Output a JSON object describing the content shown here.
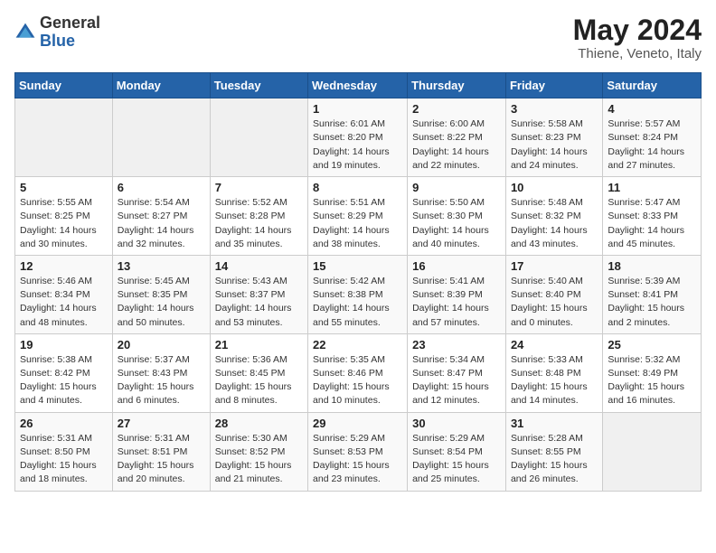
{
  "logo": {
    "general": "General",
    "blue": "Blue"
  },
  "title": "May 2024",
  "subtitle": "Thiene, Veneto, Italy",
  "weekdays": [
    "Sunday",
    "Monday",
    "Tuesday",
    "Wednesday",
    "Thursday",
    "Friday",
    "Saturday"
  ],
  "weeks": [
    [
      {
        "day": "",
        "info": ""
      },
      {
        "day": "",
        "info": ""
      },
      {
        "day": "",
        "info": ""
      },
      {
        "day": "1",
        "info": "Sunrise: 6:01 AM\nSunset: 8:20 PM\nDaylight: 14 hours\nand 19 minutes."
      },
      {
        "day": "2",
        "info": "Sunrise: 6:00 AM\nSunset: 8:22 PM\nDaylight: 14 hours\nand 22 minutes."
      },
      {
        "day": "3",
        "info": "Sunrise: 5:58 AM\nSunset: 8:23 PM\nDaylight: 14 hours\nand 24 minutes."
      },
      {
        "day": "4",
        "info": "Sunrise: 5:57 AM\nSunset: 8:24 PM\nDaylight: 14 hours\nand 27 minutes."
      }
    ],
    [
      {
        "day": "5",
        "info": "Sunrise: 5:55 AM\nSunset: 8:25 PM\nDaylight: 14 hours\nand 30 minutes."
      },
      {
        "day": "6",
        "info": "Sunrise: 5:54 AM\nSunset: 8:27 PM\nDaylight: 14 hours\nand 32 minutes."
      },
      {
        "day": "7",
        "info": "Sunrise: 5:52 AM\nSunset: 8:28 PM\nDaylight: 14 hours\nand 35 minutes."
      },
      {
        "day": "8",
        "info": "Sunrise: 5:51 AM\nSunset: 8:29 PM\nDaylight: 14 hours\nand 38 minutes."
      },
      {
        "day": "9",
        "info": "Sunrise: 5:50 AM\nSunset: 8:30 PM\nDaylight: 14 hours\nand 40 minutes."
      },
      {
        "day": "10",
        "info": "Sunrise: 5:48 AM\nSunset: 8:32 PM\nDaylight: 14 hours\nand 43 minutes."
      },
      {
        "day": "11",
        "info": "Sunrise: 5:47 AM\nSunset: 8:33 PM\nDaylight: 14 hours\nand 45 minutes."
      }
    ],
    [
      {
        "day": "12",
        "info": "Sunrise: 5:46 AM\nSunset: 8:34 PM\nDaylight: 14 hours\nand 48 minutes."
      },
      {
        "day": "13",
        "info": "Sunrise: 5:45 AM\nSunset: 8:35 PM\nDaylight: 14 hours\nand 50 minutes."
      },
      {
        "day": "14",
        "info": "Sunrise: 5:43 AM\nSunset: 8:37 PM\nDaylight: 14 hours\nand 53 minutes."
      },
      {
        "day": "15",
        "info": "Sunrise: 5:42 AM\nSunset: 8:38 PM\nDaylight: 14 hours\nand 55 minutes."
      },
      {
        "day": "16",
        "info": "Sunrise: 5:41 AM\nSunset: 8:39 PM\nDaylight: 14 hours\nand 57 minutes."
      },
      {
        "day": "17",
        "info": "Sunrise: 5:40 AM\nSunset: 8:40 PM\nDaylight: 15 hours\nand 0 minutes."
      },
      {
        "day": "18",
        "info": "Sunrise: 5:39 AM\nSunset: 8:41 PM\nDaylight: 15 hours\nand 2 minutes."
      }
    ],
    [
      {
        "day": "19",
        "info": "Sunrise: 5:38 AM\nSunset: 8:42 PM\nDaylight: 15 hours\nand 4 minutes."
      },
      {
        "day": "20",
        "info": "Sunrise: 5:37 AM\nSunset: 8:43 PM\nDaylight: 15 hours\nand 6 minutes."
      },
      {
        "day": "21",
        "info": "Sunrise: 5:36 AM\nSunset: 8:45 PM\nDaylight: 15 hours\nand 8 minutes."
      },
      {
        "day": "22",
        "info": "Sunrise: 5:35 AM\nSunset: 8:46 PM\nDaylight: 15 hours\nand 10 minutes."
      },
      {
        "day": "23",
        "info": "Sunrise: 5:34 AM\nSunset: 8:47 PM\nDaylight: 15 hours\nand 12 minutes."
      },
      {
        "day": "24",
        "info": "Sunrise: 5:33 AM\nSunset: 8:48 PM\nDaylight: 15 hours\nand 14 minutes."
      },
      {
        "day": "25",
        "info": "Sunrise: 5:32 AM\nSunset: 8:49 PM\nDaylight: 15 hours\nand 16 minutes."
      }
    ],
    [
      {
        "day": "26",
        "info": "Sunrise: 5:31 AM\nSunset: 8:50 PM\nDaylight: 15 hours\nand 18 minutes."
      },
      {
        "day": "27",
        "info": "Sunrise: 5:31 AM\nSunset: 8:51 PM\nDaylight: 15 hours\nand 20 minutes."
      },
      {
        "day": "28",
        "info": "Sunrise: 5:30 AM\nSunset: 8:52 PM\nDaylight: 15 hours\nand 21 minutes."
      },
      {
        "day": "29",
        "info": "Sunrise: 5:29 AM\nSunset: 8:53 PM\nDaylight: 15 hours\nand 23 minutes."
      },
      {
        "day": "30",
        "info": "Sunrise: 5:29 AM\nSunset: 8:54 PM\nDaylight: 15 hours\nand 25 minutes."
      },
      {
        "day": "31",
        "info": "Sunrise: 5:28 AM\nSunset: 8:55 PM\nDaylight: 15 hours\nand 26 minutes."
      },
      {
        "day": "",
        "info": ""
      }
    ]
  ]
}
